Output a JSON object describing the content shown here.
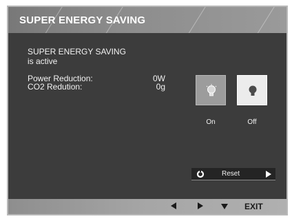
{
  "header": {
    "title": "SUPER ENERGY SAVING"
  },
  "status": {
    "line1": "SUPER ENERGY SAVING",
    "line2": "is active"
  },
  "metrics": [
    {
      "label": "Power Reduction:",
      "value": "0W"
    },
    {
      "label": "CO2 Redution:",
      "value": "0g"
    }
  ],
  "mode_buttons": [
    {
      "label": "On",
      "icon": "lightbulb-on-icon",
      "state": "selected"
    },
    {
      "label": "Off",
      "icon": "lightbulb-off-icon",
      "state": "unselected"
    }
  ],
  "reset": {
    "label": "Reset",
    "icon": "reset-icon",
    "arrow_icon": "arrow-right-icon"
  },
  "footer": {
    "keys": [
      {
        "icon": "arrow-left-icon"
      },
      {
        "icon": "arrow-right-icon"
      },
      {
        "icon": "arrow-down-icon"
      }
    ],
    "exit_label": "EXIT"
  },
  "colors": {
    "panel_bg": "#3c3c3c",
    "title_bar": "#8c8c8c",
    "text": "#f2f2f2",
    "button_on_bg": "#9c9c9c",
    "button_off_bg": "#ececec",
    "footer_bg": "#a6a6a6"
  }
}
